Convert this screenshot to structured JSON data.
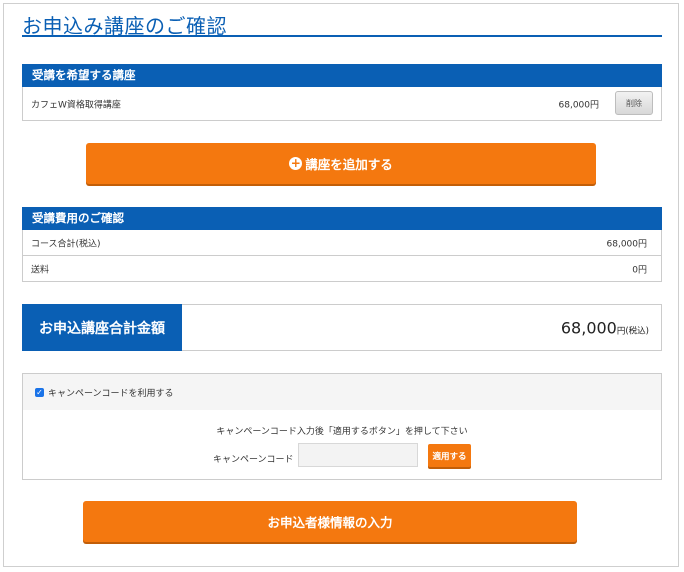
{
  "page": {
    "title": "お申込み講座のご確認"
  },
  "courses_section": {
    "header": "受講を希望する講座",
    "items": [
      {
        "name": "カフェW資格取得講座",
        "price": "68,000円",
        "delete_label": "削除"
      }
    ]
  },
  "add_course_button": {
    "icon": "plus-circle-icon",
    "label": "講座を追加する"
  },
  "fees_section": {
    "header": "受講費用のご確認",
    "rows": [
      {
        "label": "コース合計(税込)",
        "value": "68,000円"
      },
      {
        "label": "送料",
        "value": "0円"
      }
    ]
  },
  "total": {
    "label": "お申込講座合計金額",
    "amount": "68,000",
    "unit": "円(税込)"
  },
  "campaign": {
    "checkbox_label": "キャンペーンコードを利用する",
    "checked": true,
    "note": "キャンペーンコード入力後「適用するボタン」を押して下さい",
    "code_label": "キャンペーンコード",
    "code_value": "",
    "apply_label": "適用する"
  },
  "submit_button": {
    "label": "お申込者様情報の入力"
  },
  "colors": {
    "primary_blue": "#0a5fb4",
    "accent_orange": "#f4780f"
  }
}
